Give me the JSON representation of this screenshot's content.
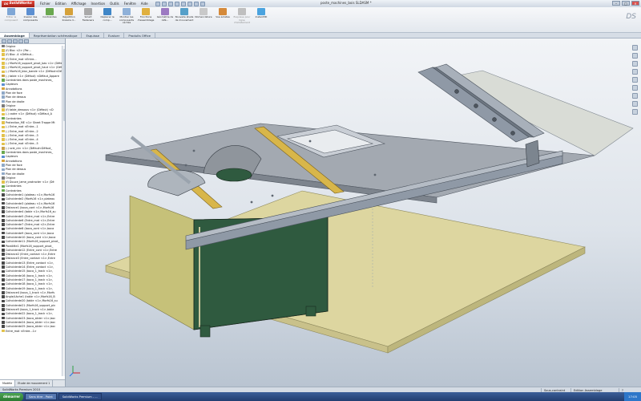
{
  "app": {
    "name": "SolidWorks",
    "brand_prefix": "DS",
    "document_title": "poste_machines_bois SLDASM *",
    "brand_color": "#c8291c"
  },
  "menus": [
    "Fichier",
    "Edition",
    "Affichage",
    "Insertion",
    "Outils",
    "Fenêtre",
    "Aide"
  ],
  "ribbon": {
    "buttons": [
      {
        "label": "Editer le composant",
        "icon": "edit-component-icon",
        "color": "#7fa7d6",
        "enabled": false
      },
      {
        "label": "Insérer des composants",
        "icon": "insert-components-icon",
        "color": "#5c8fd1",
        "enabled": true
      },
      {
        "label": "Contraintes",
        "icon": "mate-icon",
        "color": "#6aa84f",
        "enabled": true
      },
      {
        "label": "Répétition linéaire d...",
        "icon": "linear-pattern-icon",
        "color": "#d5a13a",
        "enabled": true
      },
      {
        "label": "Smart Fasteners",
        "icon": "smart-fasteners-icon",
        "color": "#a9a9a9",
        "enabled": true
      },
      {
        "label": "Déplacer le comp...",
        "icon": "move-component-icon",
        "color": "#3f86c7",
        "enabled": true
      },
      {
        "label": "Montrer les composants cachés",
        "icon": "show-hidden-icon",
        "color": "#8fb1d9",
        "enabled": true
      },
      {
        "label": "Fonctions d'assemblage",
        "icon": "assembly-features-icon",
        "color": "#e0b03f",
        "enabled": true
      },
      {
        "label": "Géométrie de réfé...",
        "icon": "reference-geometry-icon",
        "color": "#9c7ac2",
        "enabled": true
      },
      {
        "label": "Nouvelle étude de mouvement",
        "icon": "motion-study-icon",
        "color": "#56a0c9",
        "enabled": true
      },
      {
        "label": "Nomenclature",
        "icon": "bom-icon",
        "color": "#c9c9c9",
        "enabled": true
      },
      {
        "label": "Vue éclatée",
        "icon": "exploded-view-icon",
        "color": "#d58a3a",
        "enabled": true
      },
      {
        "label": "Esquisse pour ligne d'éclatement",
        "icon": "explode-line-icon",
        "color": "#bfbfbf",
        "enabled": false
      },
      {
        "label": "Instant3D",
        "icon": "instant3d-icon",
        "color": "#4aa3df",
        "enabled": true
      }
    ]
  },
  "command_tabs": [
    "Assemblage",
    "Représentation schématique",
    "Esquisse",
    "Evaluer",
    "Produits Office"
  ],
  "active_tab": "Assemblage",
  "feature_tree": [
    {
      "label": "Origine",
      "icon": "origin-icon",
      "color": "#7b7b7b"
    },
    {
      "label": "(f) Bloc <2> (Par...",
      "icon": "part-icon",
      "color": "#e2c24c"
    },
    {
      "label": "(f) Bloc -4 <Défaut...",
      "icon": "part-icon",
      "color": "#e2c24c"
    },
    {
      "label": "(f) Entre_mat <Entre...",
      "icon": "part-icon",
      "color": "#e2c24c"
    },
    {
      "label": "(-) Morfs16_support_pivot_bas <1> (Défa",
      "icon": "part-icon",
      "color": "#e2c24c"
    },
    {
      "label": "(-) Morfs16_support_pivot_haut <1> (Défa",
      "icon": "part-icon",
      "color": "#e2c24c"
    },
    {
      "label": "(-) Morfs16_bloc_bande <1> (Défaut<Défaut",
      "icon": "part-icon",
      "color": "#e2c24c"
    },
    {
      "label": "(-) table <1> (Défaut) <Défaut_Appare",
      "icon": "subassembly-icon",
      "color": "#c8a04a"
    },
    {
      "label": "Contraintes dans poste_machines_",
      "icon": "mates-folder-icon",
      "color": "#6aa84f"
    },
    {
      "label": "Capteurs",
      "icon": "sensor-icon",
      "color": "#5b8ed1"
    },
    {
      "label": "Annotations",
      "icon": "annotation-icon",
      "color": "#d6a23b"
    },
    {
      "label": "Plan de face",
      "icon": "plane-icon",
      "color": "#8fa8c6"
    },
    {
      "label": "Plan de dessus",
      "icon": "plane-icon",
      "color": "#8fa8c6"
    },
    {
      "label": "Plan de droite",
      "icon": "plane-icon",
      "color": "#8fa8c6"
    },
    {
      "label": "Origine",
      "icon": "origin-icon",
      "color": "#7b7b7b"
    },
    {
      "label": "(f) table_dessous <1> (Défaut) <D",
      "icon": "part-icon",
      "color": "#e2c24c"
    },
    {
      "label": "(-) cadre <1> (Défaut) <Défaut_A",
      "icon": "part-icon",
      "color": "#e2c24c"
    },
    {
      "label": "Contraintes",
      "icon": "mates-folder-icon",
      "color": "#6aa84f"
    },
    {
      "label": "Protection_ME <1> Sheet Trappe Mt",
      "icon": "part-icon",
      "color": "#e2c24c"
    },
    {
      "label": "(-) Entre_mat <Entre...1",
      "icon": "part-icon",
      "color": "#e2c24c"
    },
    {
      "label": "(-) Entre_mat <Entre...2",
      "icon": "part-icon",
      "color": "#e2c24c"
    },
    {
      "label": "(-) Entre_mat <Entre...3",
      "icon": "part-icon",
      "color": "#e2c24c"
    },
    {
      "label": "(-) Entre_mat <Entre...4",
      "icon": "part-icon",
      "color": "#e2c24c"
    },
    {
      "label": "(-) Entre_mat <Entre...5",
      "icon": "part-icon",
      "color": "#e2c24c"
    },
    {
      "label": "(-) scie_circ <1> (Défaut<Défaut_",
      "icon": "subassembly-icon",
      "color": "#c8a04a"
    },
    {
      "label": "Contraintes dans poste_machines_",
      "icon": "mates-folder-icon",
      "color": "#6aa84f"
    },
    {
      "label": "Capteurs",
      "icon": "sensor-icon",
      "color": "#5b8ed1"
    },
    {
      "label": "Annotations",
      "icon": "annotation-icon",
      "color": "#d6a23b"
    },
    {
      "label": "Plan de face",
      "icon": "plane-icon",
      "color": "#8fa8c6"
    },
    {
      "label": "Plan de dessus",
      "icon": "plane-icon",
      "color": "#8fa8c6"
    },
    {
      "label": "Plan de droite",
      "icon": "plane-icon",
      "color": "#8fa8c6"
    },
    {
      "label": "Origine",
      "icon": "origin-icon",
      "color": "#7b7b7b"
    },
    {
      "label": "(f) Douce_lame_protracter <1> (Dé",
      "icon": "part-icon",
      "color": "#e2c24c"
    },
    {
      "label": "Contraintes",
      "icon": "mates-folder-icon",
      "color": "#6aa84f"
    },
    {
      "label": "Contraintes",
      "icon": "mates-folder-icon",
      "color": "#6aa84f"
    },
    {
      "label": "Coïncidente1 (plateau <1>,Morfs16",
      "icon": "coincident-icon",
      "color": "#4a4a4a"
    },
    {
      "label": "Coïncidente2 (Morfs16 <1>,plateau",
      "icon": "coincident-icon",
      "color": "#4a4a4a"
    },
    {
      "label": "Coïncidente3 (plateau <1>,Morfs16",
      "icon": "coincident-icon",
      "color": "#4a4a4a"
    },
    {
      "label": "Distance1 (boca_cont <1>,Morfs16",
      "icon": "distance-icon",
      "color": "#4a4a4a"
    },
    {
      "label": "Coïncidente4 (table <1>,Morfs16_su",
      "icon": "coincident-icon",
      "color": "#4a4a4a"
    },
    {
      "label": "Coïncidente5 (Entre_mat <1>,Entre",
      "icon": "coincident-icon",
      "color": "#4a4a4a"
    },
    {
      "label": "Coïncidente6 (Entre_mat <1>,Entre",
      "icon": "coincident-icon",
      "color": "#4a4a4a"
    },
    {
      "label": "Coïncidente7 (Entre_mat <2>,Entre",
      "icon": "coincident-icon",
      "color": "#4a4a4a"
    },
    {
      "label": "Coïncidente8 (boca_cont <1>,boca",
      "icon": "coincident-icon",
      "color": "#4a4a4a"
    },
    {
      "label": "Coïncidente9 (boca_cont <1>,boca",
      "icon": "coincident-icon",
      "color": "#4a4a4a"
    },
    {
      "label": "Coïncidente10 (boca_cont <1>,boca",
      "icon": "coincident-icon",
      "color": "#4a4a4a"
    },
    {
      "label": "Coïncidente11 (Morfs16_support_pivot_",
      "icon": "coincident-icon",
      "color": "#4a4a4a"
    },
    {
      "label": "Parallèle1 (Morfs16_support_pivot_",
      "icon": "parallel-icon",
      "color": "#4a4a4a"
    },
    {
      "label": "Coïncidente12 (Entre_cont <1>,Entre",
      "icon": "coincident-icon",
      "color": "#4a4a4a"
    },
    {
      "label": "Distance2 (Entre_contact <1>,Entre",
      "icon": "distance-icon",
      "color": "#4a4a4a"
    },
    {
      "label": "Distance3 (Entre_contact <1>,Entre",
      "icon": "distance-icon",
      "color": "#4a4a4a"
    },
    {
      "label": "Coïncidente13 (Entre_contact <1>,",
      "icon": "coincident-icon",
      "color": "#4a4a4a"
    },
    {
      "label": "Coïncidente14 (Entre_contact <1>,",
      "icon": "coincident-icon",
      "color": "#4a4a4a"
    },
    {
      "label": "Coïncidente15 (boca_1_track <1>,",
      "icon": "coincident-icon",
      "color": "#4a4a4a"
    },
    {
      "label": "Coïncidente16 (boca_1_track <1>,",
      "icon": "coincident-icon",
      "color": "#4a4a4a"
    },
    {
      "label": "Coïncidente17 (boca_1_track <1>,",
      "icon": "coincident-icon",
      "color": "#4a4a4a"
    },
    {
      "label": "Coïncidente18 (boca_1_track <1>,",
      "icon": "coincident-icon",
      "color": "#4a4a4a"
    },
    {
      "label": "Coïncidente19 (boca_1_track <1>,",
      "icon": "coincident-icon",
      "color": "#4a4a4a"
    },
    {
      "label": "Distance4 (boca_1_track <1>,Morfs",
      "icon": "distance-icon",
      "color": "#4a4a4a"
    },
    {
      "label": "Angle/Lâche1 (table <1>,Morfs16_B",
      "icon": "angle-icon",
      "color": "#4a4a4a"
    },
    {
      "label": "Coïncidente20 (table <1>,Morfs16_su",
      "icon": "coincident-icon",
      "color": "#4a4a4a"
    },
    {
      "label": "Coïncidente21 (Morfs16_support_piv",
      "icon": "coincident-icon",
      "color": "#4a4a4a"
    },
    {
      "label": "Distance5 (boca_1_track <1>,table",
      "icon": "distance-icon",
      "color": "#4a4a4a"
    },
    {
      "label": "Coïncidente22 (boca_1_track <1>,",
      "icon": "coincident-icon",
      "color": "#4a4a4a"
    },
    {
      "label": "Coïncidente23 (boca_slider <1>,boc",
      "icon": "coincident-icon",
      "color": "#4a4a4a"
    },
    {
      "label": "Coïncidente24 (boca_slider <1>,boc",
      "icon": "coincident-icon",
      "color": "#4a4a4a"
    },
    {
      "label": "Coïncidente25 (boca_slider <1>,boc",
      "icon": "coincident-icon",
      "color": "#4a4a4a"
    },
    {
      "label": "Entre_mat <Entre...1>",
      "icon": "part-icon",
      "color": "#e2c24c"
    }
  ],
  "feature_tree_tabs": [
    "Modèle",
    "Etude de mouvement 1"
  ],
  "model_colors": {
    "table_top": "#a3a9b1",
    "fence_steel": "#8f99a6",
    "rails": "#d8b64a",
    "cabinet": "#2f5a3f",
    "cabinet_side": "#c6c179",
    "base_board": "#ddd6a0",
    "blade": "#8f959c"
  },
  "status": {
    "left": "SolidWorks Premium 2010",
    "right": [
      "Sous-contraint",
      "Edition Assemblage",
      "?"
    ]
  },
  "taskbar": {
    "start": "démarrer",
    "tasks": [
      "Sans titre - Paint",
      "SolidWorks Premium - ..."
    ],
    "clock": "17:05"
  }
}
